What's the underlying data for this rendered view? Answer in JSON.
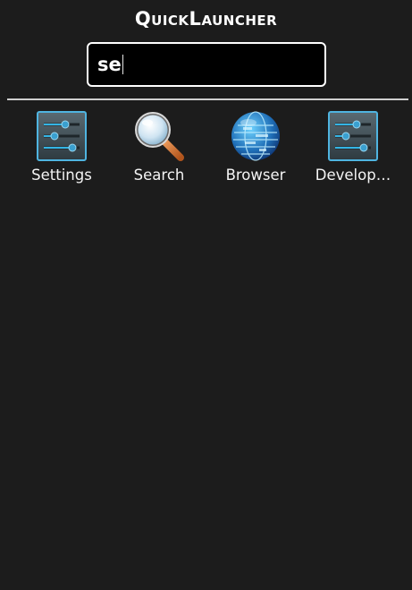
{
  "header": {
    "title": "QuickLauncher"
  },
  "search": {
    "value": "se"
  },
  "apps": [
    {
      "label": "Settings",
      "icon": "settings-sliders-icon"
    },
    {
      "label": "Search",
      "icon": "magnifier-icon"
    },
    {
      "label": "Browser",
      "icon": "globe-icon"
    },
    {
      "label": "Develop…",
      "icon": "settings-sliders-icon"
    }
  ],
  "colors": {
    "background": "#1c1c1c",
    "search_bg": "#000000",
    "search_border": "#ffffff",
    "text": "#ffffff",
    "icon_blue": "#33b5e5"
  }
}
